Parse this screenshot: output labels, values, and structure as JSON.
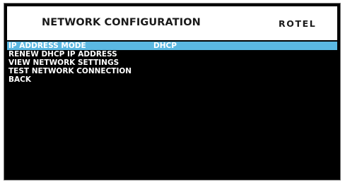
{
  "header": {
    "title": "NETWORK CONFIGURATION",
    "brand": "ROTEL"
  },
  "menu": {
    "items": [
      {
        "label": "IP ADDRESS MODE",
        "value": "DHCP",
        "selected": true
      },
      {
        "label": "RENEW DHCP IP ADDRESS"
      },
      {
        "label": "VIEW NETWORK SETTINGS"
      },
      {
        "label": "TEST NETWORK CONNECTION"
      },
      {
        "label": "BACK"
      }
    ]
  },
  "colors": {
    "highlight": "#5bb8e2",
    "background": "#000000",
    "text": "#ffffff"
  }
}
